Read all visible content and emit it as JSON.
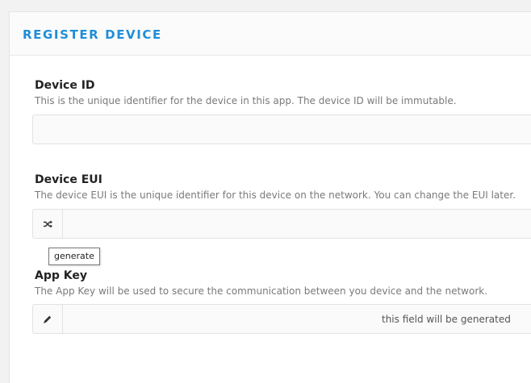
{
  "panel": {
    "title": "REGISTER DEVICE"
  },
  "fields": {
    "device_id": {
      "label": "Device ID",
      "description": "This is the unique identifier for the device in this app. The device ID will be immutable.",
      "value": ""
    },
    "device_eui": {
      "label": "Device EUI",
      "description": "The device EUI is the unique identifier for this device on the network. You can change the EUI later.",
      "value": "",
      "addon_icon": "shuffle-icon",
      "tooltip": "generate"
    },
    "app_key": {
      "label": "App Key",
      "description": "The App Key will be used to secure the communication between you device and the network.",
      "addon_icon": "pencil-icon",
      "placeholder": "this field will be generated"
    }
  },
  "colors": {
    "title": "#1f8ed8",
    "label": "#222222",
    "description": "#7a7a7a"
  }
}
